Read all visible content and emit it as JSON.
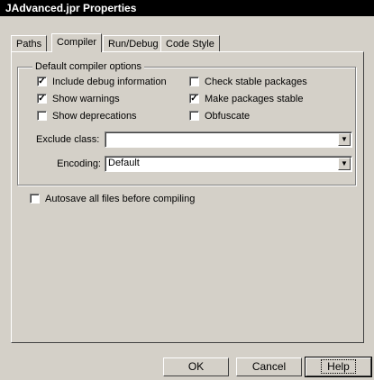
{
  "window": {
    "title": "JAdvanced.jpr Properties"
  },
  "tabs": [
    {
      "label": "Paths",
      "active": false
    },
    {
      "label": "Compiler",
      "active": true
    },
    {
      "label": "Run/Debug",
      "active": false
    },
    {
      "label": "Code Style",
      "active": false
    }
  ],
  "compiler": {
    "group_title": "Default compiler options",
    "options": {
      "include_debug": {
        "label": "Include debug information",
        "checked": true
      },
      "show_warnings": {
        "label": "Show warnings",
        "checked": true
      },
      "show_deprecations": {
        "label": "Show deprecations",
        "checked": false
      },
      "check_stable": {
        "label": "Check stable packages",
        "checked": false
      },
      "make_stable": {
        "label": "Make packages stable",
        "checked": true
      },
      "obfuscate": {
        "label": "Obfuscate",
        "checked": false
      }
    },
    "exclude_class": {
      "label": "Exclude class:",
      "value": ""
    },
    "encoding": {
      "label": "Encoding:",
      "value": "Default"
    },
    "autosave": {
      "label": "Autosave all files before compiling",
      "checked": false
    }
  },
  "buttons": {
    "ok": "OK",
    "cancel": "Cancel",
    "help": "Help"
  },
  "checkmark_glyph": "✓",
  "dropdown_glyph": "▼"
}
